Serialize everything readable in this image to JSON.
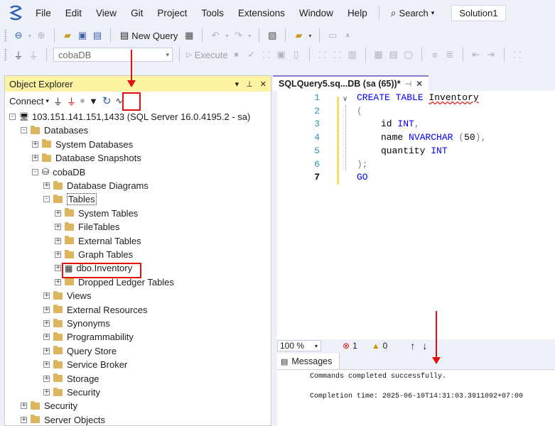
{
  "menu": {
    "items": [
      "File",
      "Edit",
      "View",
      "Git",
      "Project",
      "Tools",
      "Extensions",
      "Window",
      "Help"
    ],
    "search_label": "Search",
    "solution_name": "Solution1"
  },
  "toolbar1": {
    "new_query_label": "New Query"
  },
  "toolbar2": {
    "database_value": "cobaDB",
    "execute_label": "Execute"
  },
  "object_explorer": {
    "title": "Object Explorer",
    "connect_label": "Connect",
    "tree": [
      {
        "label": "103.151.141.151,1433 (SQL Server 16.0.4195.2 - sa)",
        "expanded": "-",
        "kind": "server"
      },
      {
        "label": "Databases",
        "expanded": "-",
        "kind": "folder"
      },
      {
        "label": "System Databases",
        "expanded": "+",
        "kind": "folder"
      },
      {
        "label": "Database Snapshots",
        "expanded": "+",
        "kind": "folder"
      },
      {
        "label": "cobaDB",
        "expanded": "-",
        "kind": "db"
      },
      {
        "label": "Database Diagrams",
        "expanded": "+",
        "kind": "folder"
      },
      {
        "label": "Tables",
        "expanded": "-",
        "kind": "folder"
      },
      {
        "label": "System Tables",
        "expanded": "+",
        "kind": "folder"
      },
      {
        "label": "FileTables",
        "expanded": "+",
        "kind": "folder"
      },
      {
        "label": "External Tables",
        "expanded": "+",
        "kind": "folder"
      },
      {
        "label": "Graph Tables",
        "expanded": "+",
        "kind": "folder"
      },
      {
        "label": "dbo.Inventory",
        "expanded": "+",
        "kind": "table"
      },
      {
        "label": "Dropped Ledger Tables",
        "expanded": "+",
        "kind": "folder"
      },
      {
        "label": "Views",
        "expanded": "+",
        "kind": "folder"
      },
      {
        "label": "External Resources",
        "expanded": "+",
        "kind": "folder"
      },
      {
        "label": "Synonyms",
        "expanded": "+",
        "kind": "folder"
      },
      {
        "label": "Programmability",
        "expanded": "+",
        "kind": "folder"
      },
      {
        "label": "Query Store",
        "expanded": "+",
        "kind": "folder"
      },
      {
        "label": "Service Broker",
        "expanded": "+",
        "kind": "folder"
      },
      {
        "label": "Storage",
        "expanded": "+",
        "kind": "folder"
      },
      {
        "label": "Security",
        "expanded": "+",
        "kind": "folder"
      },
      {
        "label": "Security",
        "expanded": "+",
        "kind": "folder"
      },
      {
        "label": "Server Objects",
        "expanded": "+",
        "kind": "folder"
      }
    ]
  },
  "editor": {
    "tab_title": "SQLQuery5.sq...DB (sa (65))*",
    "line_numbers": [
      "1",
      "2",
      "3",
      "4",
      "5",
      "6",
      "7"
    ],
    "lines": [
      {
        "kw": "CREATE TABLE ",
        "rest": "Inventory"
      },
      {
        "kw": "",
        "rest": "("
      },
      {
        "kw": "",
        "rest": "id INT,"
      },
      {
        "kw": "",
        "rest": "name NVARCHAR (50),"
      },
      {
        "kw": "",
        "rest": "quantity INT"
      },
      {
        "kw": "",
        "rest": ");"
      },
      {
        "kw": "GO",
        "rest": ""
      }
    ]
  },
  "status": {
    "zoom": "100 %",
    "errors": "1",
    "warnings": "0"
  },
  "messages": {
    "tab_label": "Messages",
    "line1": "Commands completed successfully.",
    "line2": "Completion time: 2025-06-10T14:31:03.3911092+07:00"
  }
}
